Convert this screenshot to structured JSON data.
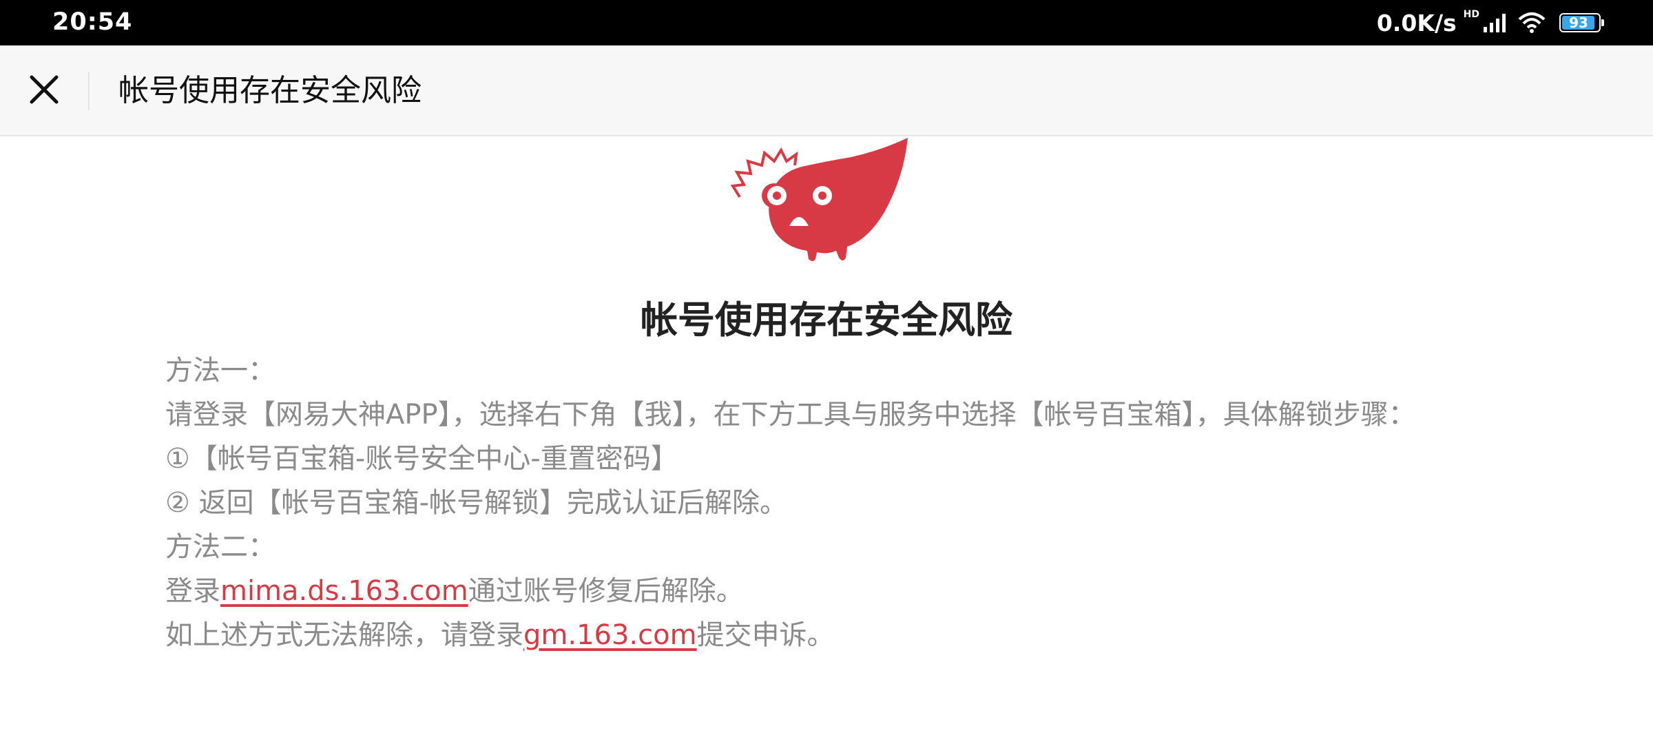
{
  "status_bar": {
    "time": "20:54",
    "net_speed": "0.0K/s",
    "network_badge": "HD",
    "battery": "93",
    "icons": [
      "signal-icon",
      "wifi-icon",
      "battery-icon"
    ]
  },
  "toolbar": {
    "close_icon": "close-icon",
    "title": "帐号使用存在安全风险"
  },
  "content": {
    "mascot_icon": "warning-mascot-icon",
    "heading": "帐号使用存在安全风险",
    "method1_label": "方法一：",
    "method1_text": "请登录【网易大神APP】，选择右下角【我】，在下方工具与服务中选择【帐号百宝箱】，具体解锁步骤：",
    "step1": "①【帐号百宝箱-账号安全中心-重置密码】",
    "step2": "② 返回【帐号百宝箱-帐号解锁】完成认证后解除。",
    "method2_label": "方法二：",
    "method2_prefix": "登录",
    "method2_link": "mima.ds.163.com",
    "method2_suffix": "通过账号修复后解除。",
    "appeal_prefix": "如上述方式无法解除，请登录",
    "appeal_link": "gm.163.com",
    "appeal_suffix": "提交申诉。"
  },
  "colors": {
    "accent": "#d83a45",
    "body_text": "#8a8a8a",
    "heading": "#222222",
    "toolbar_bg": "#f7f7f7",
    "battery_fill": "#3aa6e8"
  }
}
